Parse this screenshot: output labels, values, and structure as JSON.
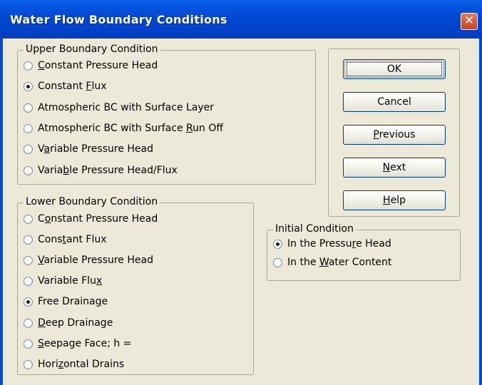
{
  "window": {
    "title": "Water Flow Boundary Conditions",
    "close_glyph": "✕"
  },
  "upper": {
    "legend": "Upper Boundary Condition",
    "options": [
      {
        "pre": "",
        "key": "C",
        "post": "onstant Pressure Head",
        "checked": false
      },
      {
        "pre": "Constant ",
        "key": "F",
        "post": "lux",
        "checked": true
      },
      {
        "pre": "Atmospheric BC with Surface Layer",
        "key": "",
        "post": "",
        "checked": false
      },
      {
        "pre": "Atmospheric BC with Surface ",
        "key": "R",
        "post": "un Off",
        "checked": false
      },
      {
        "pre": "V",
        "key": "a",
        "post": "riable Pressure Head",
        "checked": false
      },
      {
        "pre": "Varia",
        "key": "b",
        "post": "le Pressure Head/Flux",
        "checked": false
      }
    ]
  },
  "lower": {
    "legend": "Lower Boundary Condition",
    "options": [
      {
        "pre": "C",
        "key": "o",
        "post": "nstant Pressure Head",
        "checked": false
      },
      {
        "pre": "Cons",
        "key": "t",
        "post": "ant Flux",
        "checked": false
      },
      {
        "pre": "",
        "key": "V",
        "post": "ariable Pressure Head",
        "checked": false
      },
      {
        "pre": "Variable Flu",
        "key": "x",
        "post": "",
        "checked": false
      },
      {
        "pre": "Free Draina",
        "key": "g",
        "post": "e",
        "checked": true
      },
      {
        "pre": "",
        "key": "D",
        "post": "eep Drainage",
        "checked": false
      },
      {
        "pre": "",
        "key": "S",
        "post": "eepage Face; h =",
        "checked": false
      },
      {
        "pre": "Hori",
        "key": "z",
        "post": "ontal Drains",
        "checked": false
      }
    ]
  },
  "initial": {
    "legend": "Initial Condition",
    "options": [
      {
        "pre": "In the Pressu",
        "key": "r",
        "post": "e Head",
        "checked": true
      },
      {
        "pre": "In the ",
        "key": "W",
        "post": "ater Content",
        "checked": false
      }
    ]
  },
  "buttons": [
    {
      "pre": "",
      "key": "",
      "post": "OK",
      "default": true,
      "name": "ok-button"
    },
    {
      "pre": "Cancel",
      "key": "",
      "post": "",
      "default": false,
      "name": "cancel-button"
    },
    {
      "pre": "",
      "key": "P",
      "post": "revious",
      "default": false,
      "name": "previous-button"
    },
    {
      "pre": "",
      "key": "N",
      "post": "ext",
      "default": false,
      "name": "next-button"
    },
    {
      "pre": "",
      "key": "H",
      "post": "elp",
      "default": false,
      "name": "help-button"
    }
  ]
}
